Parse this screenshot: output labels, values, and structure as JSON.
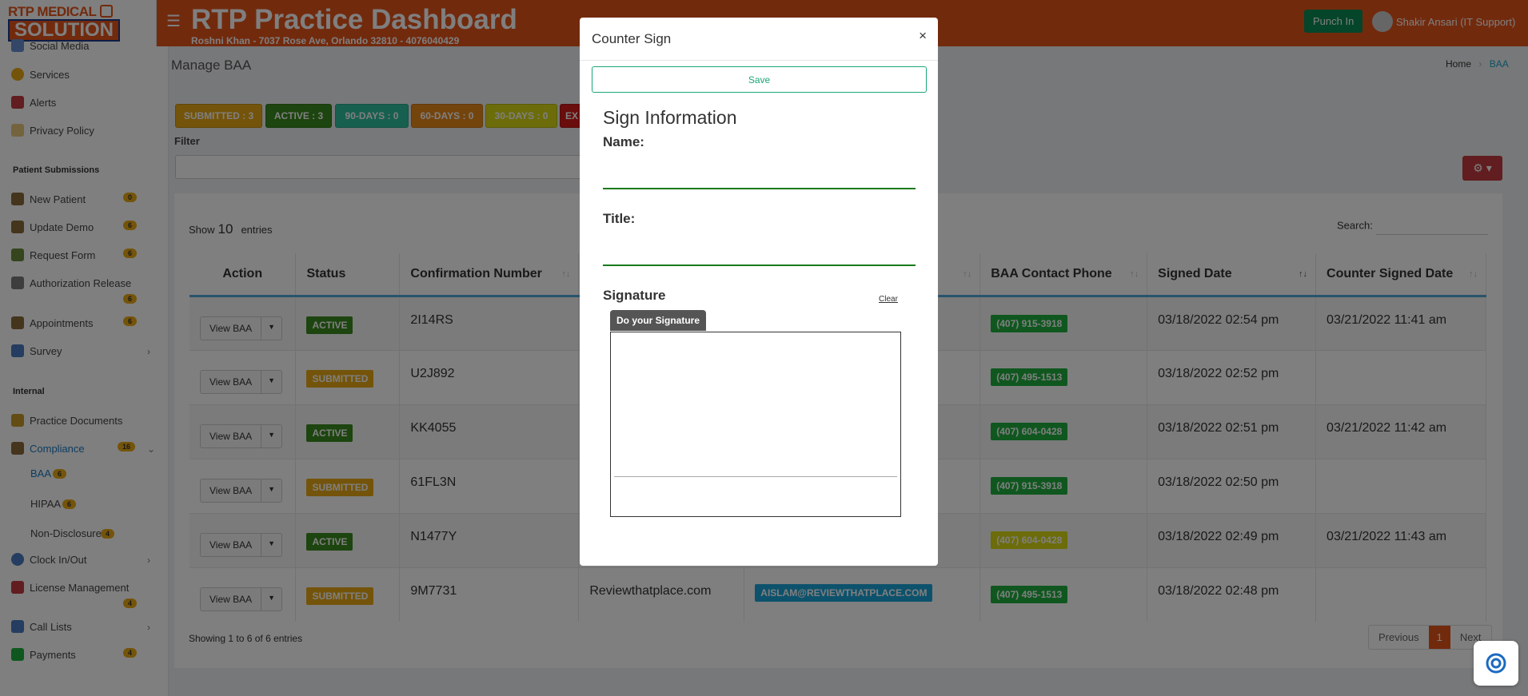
{
  "header": {
    "logo_line1": "RTP MEDICAL",
    "logo_line2": "SOLUTION",
    "title": "RTP Practice Dashboard",
    "subtitle": "Roshni Khan - 7037 Rose Ave, Orlando 32810 - 4076040429",
    "punch_label": "Punch In",
    "user_label": "Shakir Ansari (IT Support)"
  },
  "sidebar": {
    "items_top": [
      {
        "label": "Social Media",
        "icon": "social-icon"
      },
      {
        "label": "Services",
        "icon": "services-icon"
      },
      {
        "label": "Alerts",
        "icon": "alerts-icon"
      },
      {
        "label": "Privacy Policy",
        "icon": "privacy-icon"
      }
    ],
    "section_patient": "Patient Submissions",
    "patient_items": [
      {
        "label": "New Patient",
        "badge": "0"
      },
      {
        "label": "Update Demo",
        "badge": "6"
      },
      {
        "label": "Request Form",
        "badge": "6"
      },
      {
        "label": "Authorization Release",
        "badge": "6"
      },
      {
        "label": "Appointments",
        "badge": "6"
      },
      {
        "label": "Survey",
        "badge": ""
      }
    ],
    "section_internal": "Internal",
    "internal_items": [
      {
        "label": "Practice Documents"
      },
      {
        "label": "Compliance",
        "badge": "16"
      }
    ],
    "compliance_sub": [
      {
        "label": "BAA",
        "badge": "6"
      },
      {
        "label": "HIPAA",
        "badge": "6"
      },
      {
        "label": "Non-Disclosure",
        "badge": "4"
      }
    ],
    "bottom_items": [
      {
        "label": "Clock In/Out"
      },
      {
        "label": "License Management",
        "badge": "4"
      },
      {
        "label": "Call Lists"
      },
      {
        "label": "Payments",
        "badge": "4"
      }
    ]
  },
  "page": {
    "title": "Manage BAA",
    "breadcrumb_home": "Home",
    "breadcrumb_current": "BAA",
    "filter_label": "Filter",
    "status_pills": [
      {
        "label": "SUBMITTED : 3",
        "color": "#e8a914"
      },
      {
        "label": "ACTIVE : 3",
        "color": "#3a8a1e"
      },
      {
        "label": "90-DAYS : 0",
        "color": "#2fc0a0"
      },
      {
        "label": "60-DAYS : 0",
        "color": "#e8891a"
      },
      {
        "label": "30-DAYS : 0",
        "color": "#d9d914"
      },
      {
        "label": "EX",
        "color": "#d41a1a"
      }
    ],
    "show_label": "Show",
    "show_value": "10",
    "entries_label": "entries",
    "search_label": "Search:",
    "showing_text": "Showing 1 to 6 of 6 entries",
    "pager": {
      "prev": "Previous",
      "current": "1",
      "next": "Next"
    }
  },
  "table": {
    "headers": [
      "Action",
      "Status",
      "Confirmation Number",
      "",
      "",
      "BAA Contact Phone",
      "Signed Date",
      "Counter Signed Date"
    ],
    "rows": [
      {
        "action": "View BAA",
        "status": "ACTIVE",
        "conf": "2I14RS",
        "company": "",
        "email": "",
        "phone": "(407) 915-3918",
        "phone_color": "#1fae3e",
        "signed": "03/18/2022 02:54 pm",
        "counter": "03/21/2022 11:41 am"
      },
      {
        "action": "View BAA",
        "status": "SUBMITTED",
        "conf": "U2J892",
        "company": "",
        "email": "",
        "phone": "(407) 495-1513",
        "phone_color": "#1fae3e",
        "signed": "03/18/2022 02:52 pm",
        "counter": ""
      },
      {
        "action": "View BAA",
        "status": "ACTIVE",
        "conf": "KK4055",
        "company": "",
        "email": "",
        "phone": "(407) 604-0428",
        "phone_color": "#1fae3e",
        "signed": "03/18/2022 02:51 pm",
        "counter": "03/21/2022 11:42 am"
      },
      {
        "action": "View BAA",
        "status": "SUBMITTED",
        "conf": "61FL3N",
        "company": "",
        "email": "",
        "phone": "(407) 915-3918",
        "phone_color": "#1fae3e",
        "signed": "03/18/2022 02:50 pm",
        "counter": ""
      },
      {
        "action": "View BAA",
        "status": "ACTIVE",
        "conf": "N1477Y",
        "company": "",
        "email": "",
        "phone": "(407) 604-0428",
        "phone_color": "#d9d914",
        "signed": "03/18/2022 02:49 pm",
        "counter": "03/21/2022 11:43 am"
      },
      {
        "action": "View BAA",
        "status": "SUBMITTED",
        "conf": "9M7731",
        "company": "Reviewthatplace.com",
        "email": "AISLAM@REVIEWTHATPLACE.COM",
        "phone": "(407) 495-1513",
        "phone_color": "#1fae3e",
        "signed": "03/18/2022 02:48 pm",
        "counter": ""
      }
    ]
  },
  "modal": {
    "title": "Counter Sign",
    "close": "×",
    "save_label": "Save",
    "section_title": "Sign Information",
    "name_label": "Name:",
    "title_label": "Title:",
    "signature_label": "Signature",
    "clear_label": "Clear",
    "sig_tab_label": "Do your Signature"
  }
}
